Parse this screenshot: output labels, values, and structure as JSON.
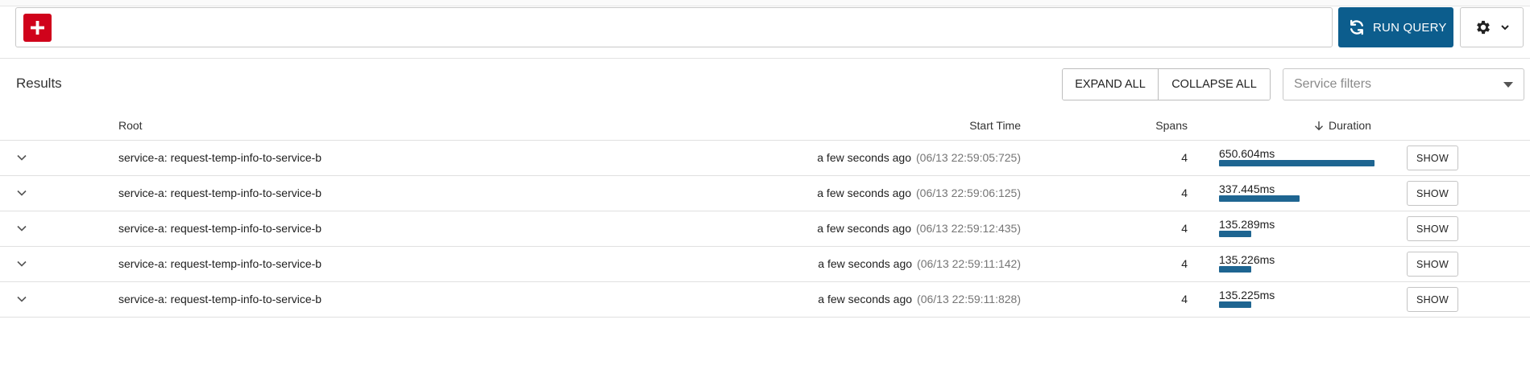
{
  "toolbar": {
    "run_query_label": "RUN QUERY",
    "add_icon": "plus-icon",
    "run_icon": "refresh-icon",
    "settings_icon": "gear-icon"
  },
  "results": {
    "title": "Results",
    "expand_all_label": "EXPAND ALL",
    "collapse_all_label": "COLLAPSE ALL",
    "service_filter_placeholder": "Service filters"
  },
  "table": {
    "headers": {
      "root": "Root",
      "start_time": "Start Time",
      "spans": "Spans",
      "duration": "Duration"
    },
    "sort": {
      "column": "Duration",
      "direction": "descending"
    },
    "rows": [
      {
        "root": "service-a: request-temp-info-to-service-b",
        "start_relative": "a few seconds ago",
        "start_absolute": "(06/13 22:59:05:725)",
        "spans": "4",
        "duration": "650.604ms",
        "duration_fraction": 1.0,
        "show_label": "SHOW"
      },
      {
        "root": "service-a: request-temp-info-to-service-b",
        "start_relative": "a few seconds ago",
        "start_absolute": "(06/13 22:59:06:125)",
        "spans": "4",
        "duration": "337.445ms",
        "duration_fraction": 0.5187,
        "show_label": "SHOW"
      },
      {
        "root": "service-a: request-temp-info-to-service-b",
        "start_relative": "a few seconds ago",
        "start_absolute": "(06/13 22:59:12:435)",
        "spans": "4",
        "duration": "135.289ms",
        "duration_fraction": 0.2079,
        "show_label": "SHOW"
      },
      {
        "root": "service-a: request-temp-info-to-service-b",
        "start_relative": "a few seconds ago",
        "start_absolute": "(06/13 22:59:11:142)",
        "spans": "4",
        "duration": "135.226ms",
        "duration_fraction": 0.2078,
        "show_label": "SHOW"
      },
      {
        "root": "service-a: request-temp-info-to-service-b",
        "start_relative": "a few seconds ago",
        "start_absolute": "(06/13 22:59:11:828)",
        "spans": "4",
        "duration": "135.225ms",
        "duration_fraction": 0.2078,
        "show_label": "SHOW"
      }
    ]
  },
  "colors": {
    "add_button": "#d0021b",
    "run_button": "#0c5d8d",
    "duration_bar": "#1e6591"
  }
}
